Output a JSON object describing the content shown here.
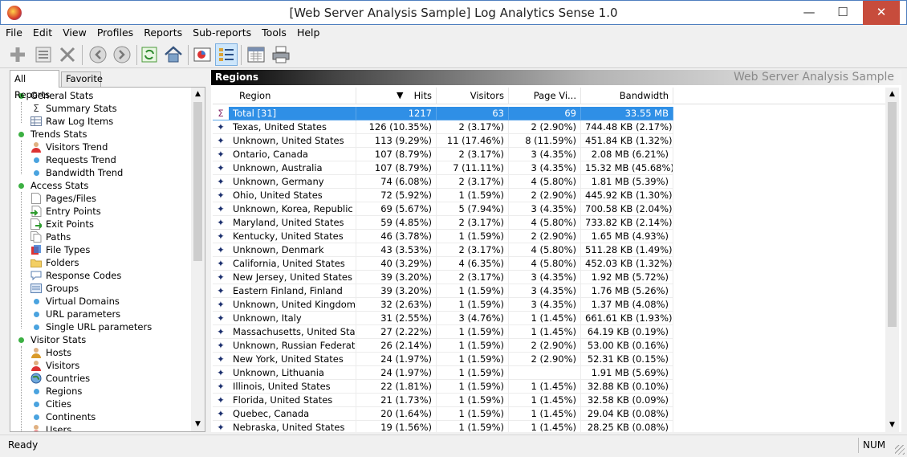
{
  "window": {
    "title": "[Web Server Analysis Sample] Log Analytics Sense 1.0",
    "min_glyph": "—",
    "max_glyph": "☐",
    "close_glyph": "✕"
  },
  "menu": [
    "File",
    "Edit",
    "View",
    "Profiles",
    "Reports",
    "Sub-reports",
    "Tools",
    "Help"
  ],
  "toolbar": {
    "icons": [
      "add-icon",
      "properties-icon",
      "delete-icon",
      "back-icon",
      "forward-icon",
      "refresh-icon",
      "home-icon",
      "chart-icon",
      "list-icon",
      "calendar-icon",
      "print-icon"
    ]
  },
  "left": {
    "tabs": [
      "All Reports",
      "Favorite"
    ],
    "tree": [
      {
        "label": "General Stats",
        "level": 0,
        "icon": "green-dot"
      },
      {
        "label": "Summary Stats",
        "level": 1,
        "icon": "sigma-icon"
      },
      {
        "label": "Raw Log Items",
        "level": 1,
        "icon": "table-icon"
      },
      {
        "label": "Trends Stats",
        "level": 0,
        "icon": "green-dot"
      },
      {
        "label": "Visitors Trend",
        "level": 1,
        "icon": "user-icon"
      },
      {
        "label": "Requests Trend",
        "level": 1,
        "icon": "blue-dot"
      },
      {
        "label": "Bandwidth Trend",
        "level": 1,
        "icon": "blue-dot"
      },
      {
        "label": "Access Stats",
        "level": 0,
        "icon": "green-dot"
      },
      {
        "label": "Pages/Files",
        "level": 1,
        "icon": "page-icon"
      },
      {
        "label": "Entry Points",
        "level": 1,
        "icon": "entry-icon"
      },
      {
        "label": "Exit Points",
        "level": 1,
        "icon": "exit-icon"
      },
      {
        "label": "Paths",
        "level": 1,
        "icon": "paths-icon"
      },
      {
        "label": "File Types",
        "level": 1,
        "icon": "filetypes-icon"
      },
      {
        "label": "Folders",
        "level": 1,
        "icon": "folder-icon"
      },
      {
        "label": "Response Codes",
        "level": 1,
        "icon": "response-icon"
      },
      {
        "label": "Groups",
        "level": 1,
        "icon": "groups-icon"
      },
      {
        "label": "Virtual Domains",
        "level": 1,
        "icon": "blue-dot"
      },
      {
        "label": "URL parameters",
        "level": 1,
        "icon": "blue-dot"
      },
      {
        "label": "Single URL parameters",
        "level": 1,
        "icon": "blue-dot"
      },
      {
        "label": "Visitor Stats",
        "level": 0,
        "icon": "green-dot"
      },
      {
        "label": "Hosts",
        "level": 1,
        "icon": "host-icon"
      },
      {
        "label": "Visitors",
        "level": 1,
        "icon": "user-icon"
      },
      {
        "label": "Countries",
        "level": 1,
        "icon": "globe-icon"
      },
      {
        "label": "Regions",
        "level": 1,
        "icon": "blue-dot"
      },
      {
        "label": "Cities",
        "level": 1,
        "icon": "blue-dot"
      },
      {
        "label": "Continents",
        "level": 1,
        "icon": "blue-dot"
      },
      {
        "label": "Users",
        "level": 1,
        "icon": "user-icon"
      }
    ]
  },
  "report": {
    "title": "Regions",
    "subtitle": "Web Server Analysis Sample",
    "columns": [
      "Region",
      "Hits",
      "Visitors",
      "Page Vi...",
      "Bandwidth"
    ],
    "sort_glyph": "▼",
    "total": {
      "icon": "Σ",
      "cells": [
        "Total [31]",
        "1217",
        "63",
        "69",
        "33.55 MB"
      ]
    },
    "row_icon": "✦",
    "rows": [
      [
        "Texas, United States",
        "126 (10.35%)",
        "2 (3.17%)",
        "2 (2.90%)",
        "744.48 KB (2.17%)"
      ],
      [
        "Unknown, United States",
        "113 (9.29%)",
        "11 (17.46%)",
        "8 (11.59%)",
        "451.84 KB (1.32%)"
      ],
      [
        "Ontario, Canada",
        "107 (8.79%)",
        "2 (3.17%)",
        "3 (4.35%)",
        "2.08 MB (6.21%)"
      ],
      [
        "Unknown, Australia",
        "107 (8.79%)",
        "7 (11.11%)",
        "3 (4.35%)",
        "15.32 MB (45.68%)"
      ],
      [
        "Unknown, Germany",
        "74 (6.08%)",
        "2 (3.17%)",
        "4 (5.80%)",
        "1.81 MB (5.39%)"
      ],
      [
        "Ohio, United States",
        "72 (5.92%)",
        "1 (1.59%)",
        "2 (2.90%)",
        "445.92 KB (1.30%)"
      ],
      [
        "Unknown, Korea, Republic of",
        "69 (5.67%)",
        "5 (7.94%)",
        "3 (4.35%)",
        "700.58 KB (2.04%)"
      ],
      [
        "Maryland, United States",
        "59 (4.85%)",
        "2 (3.17%)",
        "4 (5.80%)",
        "733.82 KB (2.14%)"
      ],
      [
        "Kentucky, United States",
        "46 (3.78%)",
        "1 (1.59%)",
        "2 (2.90%)",
        "1.65 MB (4.93%)"
      ],
      [
        "Unknown, Denmark",
        "43 (3.53%)",
        "2 (3.17%)",
        "4 (5.80%)",
        "511.28 KB (1.49%)"
      ],
      [
        "California, United States",
        "40 (3.29%)",
        "4 (6.35%)",
        "4 (5.80%)",
        "452.03 KB (1.32%)"
      ],
      [
        "New Jersey, United States",
        "39 (3.20%)",
        "2 (3.17%)",
        "3 (4.35%)",
        "1.92 MB (5.72%)"
      ],
      [
        "Eastern Finland, Finland",
        "39 (3.20%)",
        "1 (1.59%)",
        "3 (4.35%)",
        "1.76 MB (5.26%)"
      ],
      [
        "Unknown, United Kingdom",
        "32 (2.63%)",
        "1 (1.59%)",
        "3 (4.35%)",
        "1.37 MB (4.08%)"
      ],
      [
        "Unknown, Italy",
        "31 (2.55%)",
        "3 (4.76%)",
        "1 (1.45%)",
        "661.61 KB (1.93%)"
      ],
      [
        "Massachusetts, United States",
        "27 (2.22%)",
        "1 (1.59%)",
        "1 (1.45%)",
        "64.19 KB (0.19%)"
      ],
      [
        "Unknown, Russian Federation",
        "26 (2.14%)",
        "1 (1.59%)",
        "2 (2.90%)",
        "53.00 KB (0.16%)"
      ],
      [
        "New York, United States",
        "24 (1.97%)",
        "1 (1.59%)",
        "2 (2.90%)",
        "52.31 KB (0.15%)"
      ],
      [
        "Unknown, Lithuania",
        "24 (1.97%)",
        "1 (1.59%)",
        "",
        "1.91 MB (5.69%)"
      ],
      [
        "Illinois, United States",
        "22 (1.81%)",
        "1 (1.59%)",
        "1 (1.45%)",
        "32.88 KB (0.10%)"
      ],
      [
        "Florida, United States",
        "21 (1.73%)",
        "1 (1.59%)",
        "1 (1.45%)",
        "32.58 KB (0.09%)"
      ],
      [
        "Quebec, Canada",
        "20 (1.64%)",
        "1 (1.59%)",
        "1 (1.45%)",
        "29.04 KB (0.08%)"
      ],
      [
        "Nebraska, United States",
        "19 (1.56%)",
        "1 (1.59%)",
        "1 (1.45%)",
        "28.25 KB (0.08%)"
      ]
    ]
  },
  "status": {
    "text": "Ready",
    "num": "NUM"
  }
}
